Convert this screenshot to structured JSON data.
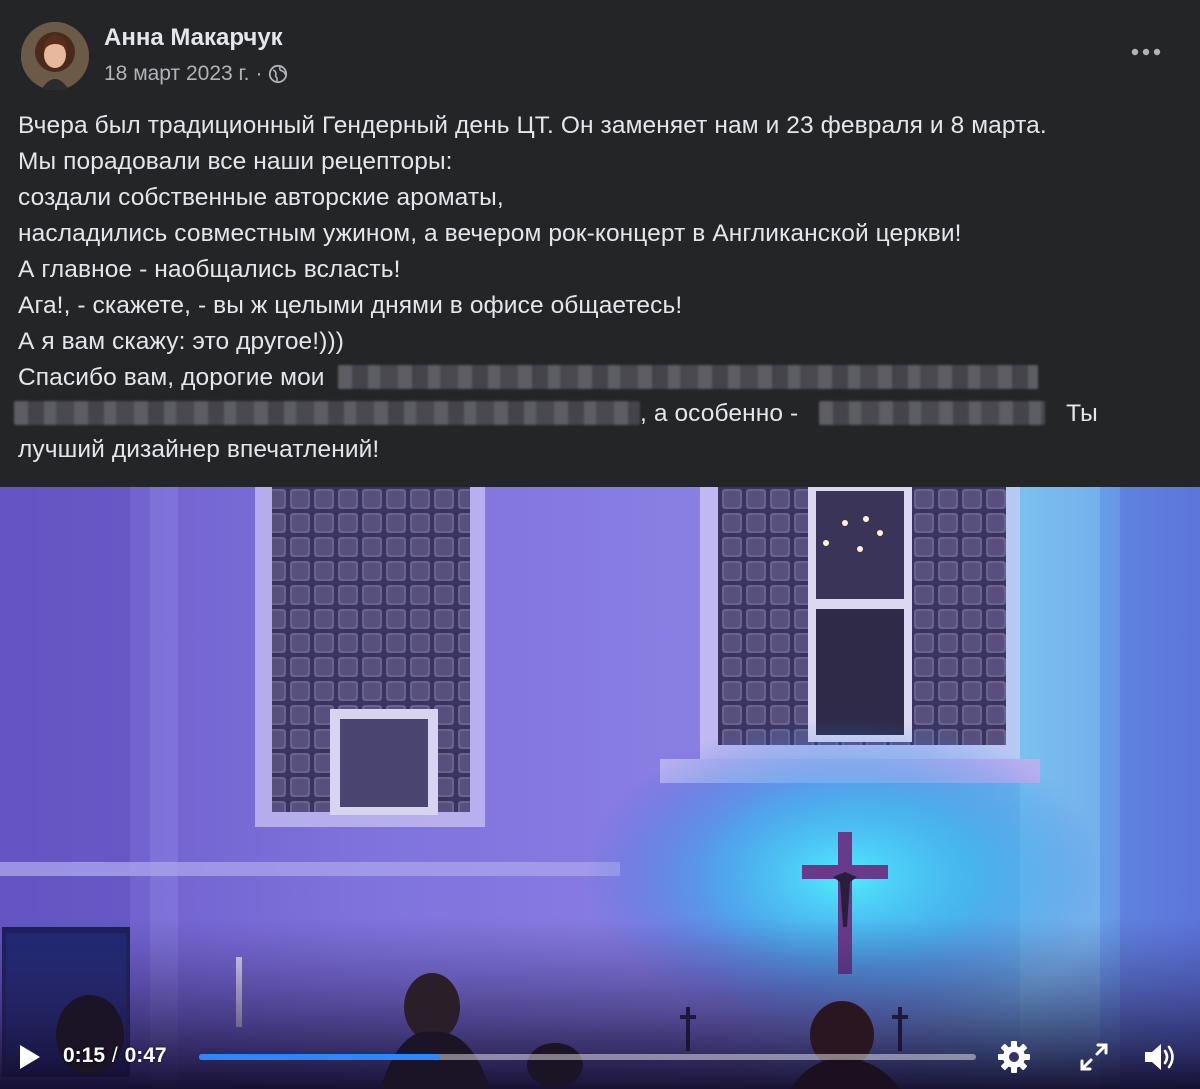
{
  "post": {
    "author_name": "Анна Макарчук",
    "date": "18 март 2023 г.",
    "separator": "·",
    "privacy_icon": "globe-icon",
    "more_icon": "more-horizontal-icon",
    "text_lines": [
      "Вчера был традиционный Гендерный день ЦТ. Он заменяет нам и  23 февраля и 8 марта.",
      "Мы порадовали все наши рецепторы:",
      "создали собственные  авторские ароматы,",
      "насладились совместным ужином, а вечером рок-концерт в Англиканской церкви!",
      "А главное - наобщались всласть!",
      "Ага!, - скажете, - вы ж целыми днями в офисе общаетесь!",
      "А я вам скажу: это другое!)))"
    ],
    "thanks_prefix": "Спасибо вам, дорогие мои",
    "especially_text": ", а особенно -",
    "you_text": "Ты",
    "last_line": "лучший дизайнер впечатлений!"
  },
  "video": {
    "current_time": "0:15",
    "time_separator": "/",
    "duration": "0:47",
    "progress_fraction": 0.31,
    "icons": {
      "play": "play-icon",
      "settings": "gear-icon",
      "fullscreen": "fullscreen-icon",
      "volume": "volume-icon"
    },
    "accent_color": "#2d88ff"
  }
}
